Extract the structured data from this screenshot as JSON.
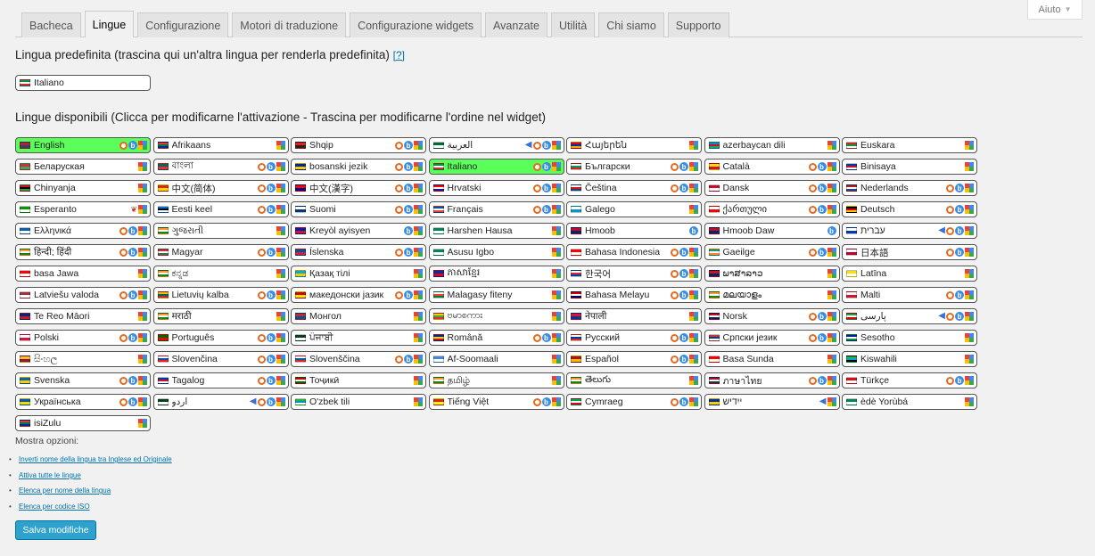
{
  "help": {
    "label": "Aiuto"
  },
  "tabs": [
    "Bacheca",
    "Lingue",
    "Configurazione",
    "Motori di traduzione",
    "Configurazione widgets",
    "Avanzate",
    "Utilità",
    "Chi siamo",
    "Supporto"
  ],
  "active_tab": "Lingue",
  "default_section": {
    "title": "Lingua predefinita (trascina qui un'altra lingua per renderla predefinita)",
    "help_link": "[?]"
  },
  "default_language": {
    "name": "Italiano",
    "flag_colors": [
      "#009246",
      "#ffffff",
      "#ce2b37"
    ]
  },
  "available_section": {
    "title": "Lingue disponibili (Clicca per modificarne l'attivazione - Trascina per modificarne l'ordine nel widget)"
  },
  "languages": [
    {
      "name": "English",
      "active": true,
      "icons": [
        "apertium",
        "bing",
        "google"
      ],
      "flag_colors": [
        "#b22234",
        "#3c3b6e"
      ]
    },
    {
      "name": "Afrikaans",
      "icons": [
        "google"
      ],
      "flag_colors": [
        "#de3831",
        "#007a4d",
        "#002395"
      ]
    },
    {
      "name": "Shqip",
      "icons": [
        "apertium",
        "bing",
        "google"
      ],
      "flag_colors": [
        "#e41e20",
        "#222222"
      ]
    },
    {
      "name": "العربية",
      "icons": [
        "arrow",
        "apertium",
        "bing",
        "google"
      ],
      "flag_colors": [
        "#006c35",
        "#ffffff"
      ]
    },
    {
      "name": "Հայերեն",
      "icons": [
        "google"
      ],
      "flag_colors": [
        "#d90012",
        "#0033a0",
        "#f2a800"
      ]
    },
    {
      "name": "azerbaycan dili",
      "icons": [
        "google"
      ],
      "flag_colors": [
        "#0092bc",
        "#e00034",
        "#00af66"
      ]
    },
    {
      "name": "Euskara",
      "icons": [
        "google"
      ],
      "flag_colors": [
        "#d52b1e",
        "#009b48",
        "#ffffff"
      ]
    },
    {
      "name": "Беларуская",
      "icons": [
        "google"
      ],
      "flag_colors": [
        "#c8313e",
        "#4aa657"
      ]
    },
    {
      "name": "বাংলা",
      "icons": [
        "apertium",
        "bing",
        "google"
      ],
      "flag_colors": [
        "#006a4e",
        "#f42a41"
      ]
    },
    {
      "name": "bosanski jezik",
      "icons": [
        "apertium",
        "bing",
        "google"
      ],
      "flag_colors": [
        "#002395",
        "#fecb00"
      ]
    },
    {
      "name": "Italiano",
      "active": true,
      "icons": [
        "apertium",
        "bing",
        "google"
      ],
      "flag_colors": [
        "#009246",
        "#ffffff",
        "#ce2b37"
      ]
    },
    {
      "name": "Български",
      "icons": [
        "apertium",
        "bing",
        "google"
      ],
      "flag_colors": [
        "#ffffff",
        "#00966e",
        "#d62612"
      ]
    },
    {
      "name": "Català",
      "icons": [
        "apertium",
        "bing",
        "google"
      ],
      "flag_colors": [
        "#fcdd09",
        "#da121a"
      ]
    },
    {
      "name": "Binisaya",
      "icons": [
        "google"
      ],
      "flag_colors": [
        "#0038a8",
        "#ce1126",
        "#ffffff"
      ]
    },
    {
      "name": "Chinyanja",
      "icons": [
        "google"
      ],
      "flag_colors": [
        "#ce1126",
        "#000000",
        "#339e35"
      ]
    },
    {
      "name": "中文(简体)",
      "icons": [
        "apertium",
        "bing",
        "google"
      ],
      "flag_colors": [
        "#de2910",
        "#ffde00"
      ]
    },
    {
      "name": "中文(漢字)",
      "icons": [
        "apertium",
        "bing",
        "google"
      ],
      "flag_colors": [
        "#fe0000",
        "#000095"
      ]
    },
    {
      "name": "Hrvatski",
      "icons": [
        "apertium",
        "bing",
        "google"
      ],
      "flag_colors": [
        "#ff0000",
        "#ffffff",
        "#171796"
      ]
    },
    {
      "name": "Čeština",
      "icons": [
        "apertium",
        "bing",
        "google"
      ],
      "flag_colors": [
        "#ffffff",
        "#d7141a",
        "#11457e"
      ]
    },
    {
      "name": "Dansk",
      "icons": [
        "apertium",
        "bing",
        "google"
      ],
      "flag_colors": [
        "#c60c30",
        "#ffffff"
      ]
    },
    {
      "name": "Nederlands",
      "icons": [
        "apertium",
        "bing",
        "google"
      ],
      "flag_colors": [
        "#ae1c28",
        "#ffffff",
        "#21468b"
      ]
    },
    {
      "name": "Esperanto",
      "icons": [
        "butterfly",
        "google"
      ],
      "flag_colors": [
        "#009900",
        "#ffffff"
      ]
    },
    {
      "name": "Eesti keel",
      "icons": [
        "apertium",
        "bing",
        "google"
      ],
      "flag_colors": [
        "#0072ce",
        "#000000",
        "#ffffff"
      ]
    },
    {
      "name": "Suomi",
      "icons": [
        "apertium",
        "bing",
        "google"
      ],
      "flag_colors": [
        "#ffffff",
        "#003580"
      ]
    },
    {
      "name": "Français",
      "icons": [
        "apertium",
        "bing",
        "google"
      ],
      "flag_colors": [
        "#0055a4",
        "#ffffff",
        "#ef4135"
      ]
    },
    {
      "name": "Galego",
      "icons": [
        "google"
      ],
      "flag_colors": [
        "#ffffff",
        "#0099cc"
      ]
    },
    {
      "name": "ქართული",
      "icons": [
        "apertium",
        "bing",
        "google"
      ],
      "flag_colors": [
        "#ffffff",
        "#ff0000"
      ]
    },
    {
      "name": "Deutsch",
      "icons": [
        "apertium",
        "bing",
        "google"
      ],
      "flag_colors": [
        "#000000",
        "#dd0000",
        "#ffce00"
      ]
    },
    {
      "name": "Ελληνικά",
      "icons": [
        "apertium",
        "bing",
        "google"
      ],
      "flag_colors": [
        "#0d5eaf",
        "#ffffff"
      ]
    },
    {
      "name": "ગુજરાતી",
      "icons": [
        "google"
      ],
      "flag_colors": [
        "#ff9933",
        "#ffffff",
        "#138808"
      ]
    },
    {
      "name": "Kreyòl ayisyen",
      "icons": [
        "bing",
        "google"
      ],
      "flag_colors": [
        "#00209f",
        "#d21034"
      ]
    },
    {
      "name": "Harshen Hausa",
      "icons": [
        "google"
      ],
      "flag_colors": [
        "#008751",
        "#ffffff"
      ]
    },
    {
      "name": "Hmoob",
      "icons": [
        "bing"
      ],
      "flag_colors": [
        "#bf0a30",
        "#002868"
      ]
    },
    {
      "name": "Hmoob Daw",
      "icons": [
        "bing"
      ],
      "flag_colors": [
        "#bf0a30",
        "#002868"
      ]
    },
    {
      "name": "עברית",
      "icons": [
        "arrow",
        "apertium",
        "bing",
        "google"
      ],
      "flag_colors": [
        "#ffffff",
        "#0038b8"
      ]
    },
    {
      "name": "हिन्दी; हिंदी",
      "icons": [
        "apertium",
        "bing",
        "google"
      ],
      "flag_colors": [
        "#ff9933",
        "#ffffff",
        "#138808"
      ]
    },
    {
      "name": "Magyar",
      "icons": [
        "apertium",
        "bing",
        "google"
      ],
      "flag_colors": [
        "#cd2a3e",
        "#ffffff",
        "#436f4d"
      ]
    },
    {
      "name": "Íslenska",
      "icons": [
        "apertium",
        "bing",
        "google"
      ],
      "flag_colors": [
        "#02529c",
        "#dc1e35"
      ]
    },
    {
      "name": "Asusu Igbo",
      "icons": [
        "google"
      ],
      "flag_colors": [
        "#008751",
        "#ffffff"
      ]
    },
    {
      "name": "Bahasa Indonesia",
      "icons": [
        "apertium",
        "bing",
        "google"
      ],
      "flag_colors": [
        "#ff0000",
        "#ffffff"
      ]
    },
    {
      "name": "Gaeilge",
      "icons": [
        "apertium",
        "bing",
        "google"
      ],
      "flag_colors": [
        "#169b62",
        "#ffffff",
        "#ff883e"
      ]
    },
    {
      "name": "日本語",
      "icons": [
        "apertium",
        "bing",
        "google"
      ],
      "flag_colors": [
        "#ffffff",
        "#bc002d"
      ]
    },
    {
      "name": "basa Jawa",
      "icons": [
        "google"
      ],
      "flag_colors": [
        "#ff0000",
        "#ffffff"
      ]
    },
    {
      "name": "ಕನ್ನಡ",
      "icons": [
        "google"
      ],
      "flag_colors": [
        "#ff9933",
        "#ffffff",
        "#138808"
      ]
    },
    {
      "name": "Қазақ тілі",
      "icons": [
        "google"
      ],
      "flag_colors": [
        "#00afca",
        "#fec50c"
      ]
    },
    {
      "name": "ភាសាខ្មែរ",
      "icons": [
        "google"
      ],
      "flag_colors": [
        "#032ea1",
        "#e00025"
      ]
    },
    {
      "name": "한국어",
      "icons": [
        "apertium",
        "bing",
        "google"
      ],
      "flag_colors": [
        "#ffffff",
        "#cd2e3a",
        "#0047a0"
      ]
    },
    {
      "name": "ພາສາລາວ",
      "icons": [
        "google"
      ],
      "flag_colors": [
        "#ce1126",
        "#002868"
      ]
    },
    {
      "name": "Latīna",
      "icons": [
        "google"
      ],
      "flag_colors": [
        "#ffe000",
        "#ffffff"
      ]
    },
    {
      "name": "Latviešu valoda",
      "icons": [
        "apertium",
        "bing",
        "google"
      ],
      "flag_colors": [
        "#9e3039",
        "#ffffff"
      ]
    },
    {
      "name": "Lietuvių kalba",
      "icons": [
        "apertium",
        "bing",
        "google"
      ],
      "flag_colors": [
        "#fdb913",
        "#006a44",
        "#c1272d"
      ]
    },
    {
      "name": "македонски јазик",
      "icons": [
        "apertium",
        "bing",
        "google"
      ],
      "flag_colors": [
        "#d20000",
        "#ffe600"
      ]
    },
    {
      "name": "Malagasy fiteny",
      "icons": [
        "google"
      ],
      "flag_colors": [
        "#ffffff",
        "#fc3d32",
        "#007e3a"
      ]
    },
    {
      "name": "Bahasa Melayu",
      "icons": [
        "apertium",
        "bing",
        "google"
      ],
      "flag_colors": [
        "#cc0001",
        "#ffffff",
        "#010066"
      ]
    },
    {
      "name": "മലയാളം",
      "icons": [
        "google"
      ],
      "flag_colors": [
        "#ff9933",
        "#ffffff",
        "#138808"
      ]
    },
    {
      "name": "Malti",
      "icons": [
        "apertium",
        "bing",
        "google"
      ],
      "flag_colors": [
        "#ffffff",
        "#cf142b"
      ]
    },
    {
      "name": "Te Reo Māori",
      "icons": [
        "google"
      ],
      "flag_colors": [
        "#00247d",
        "#cc142b"
      ]
    },
    {
      "name": "मराठी",
      "icons": [
        "google"
      ],
      "flag_colors": [
        "#ff9933",
        "#ffffff",
        "#138808"
      ]
    },
    {
      "name": "Монгол",
      "icons": [
        "google"
      ],
      "flag_colors": [
        "#c4272f",
        "#015197"
      ]
    },
    {
      "name": "ဗမာစကား",
      "icons": [
        "google"
      ],
      "flag_colors": [
        "#fecb00",
        "#34b233",
        "#ea2839"
      ]
    },
    {
      "name": "नेपाली",
      "icons": [
        "google"
      ],
      "flag_colors": [
        "#dc143c",
        "#003893"
      ]
    },
    {
      "name": "Norsk",
      "icons": [
        "apertium",
        "bing",
        "google"
      ],
      "flag_colors": [
        "#ba0c2f",
        "#ffffff",
        "#00205b"
      ]
    },
    {
      "name": "پارسی",
      "icons": [
        "arrow",
        "apertium",
        "bing",
        "google"
      ],
      "flag_colors": [
        "#239f40",
        "#ffffff",
        "#da0000"
      ]
    },
    {
      "name": "Polski",
      "icons": [
        "apertium",
        "bing",
        "google"
      ],
      "flag_colors": [
        "#ffffff",
        "#dc143c"
      ]
    },
    {
      "name": "Português",
      "icons": [
        "apertium",
        "bing",
        "google"
      ],
      "flag_colors": [
        "#006600",
        "#ff0000"
      ]
    },
    {
      "name": "ਪੰਜਾਬੀ",
      "icons": [
        "google"
      ],
      "flag_colors": [
        "#01411c",
        "#ffffff"
      ]
    },
    {
      "name": "Română",
      "icons": [
        "apertium",
        "bing",
        "google"
      ],
      "flag_colors": [
        "#002b7f",
        "#fcd116",
        "#ce1126"
      ]
    },
    {
      "name": "Русский",
      "icons": [
        "apertium",
        "bing",
        "google"
      ],
      "flag_colors": [
        "#ffffff",
        "#0039a6",
        "#d52b1e"
      ]
    },
    {
      "name": "Српски језик",
      "icons": [
        "apertium",
        "bing",
        "google"
      ],
      "flag_colors": [
        "#c6363c",
        "#0c4076",
        "#ffffff"
      ]
    },
    {
      "name": "Sesotho",
      "icons": [
        "google"
      ],
      "flag_colors": [
        "#00209f",
        "#ffffff",
        "#009543"
      ]
    },
    {
      "name": "සිංහල",
      "icons": [
        "google"
      ],
      "flag_colors": [
        "#ffbe29",
        "#8d153a"
      ]
    },
    {
      "name": "Slovenčina",
      "icons": [
        "apertium",
        "bing",
        "google"
      ],
      "flag_colors": [
        "#ffffff",
        "#0b4ea2",
        "#ee1c25"
      ]
    },
    {
      "name": "Slovenščina",
      "icons": [
        "apertium",
        "bing",
        "google"
      ],
      "flag_colors": [
        "#ffffff",
        "#005da4",
        "#ed1c24"
      ]
    },
    {
      "name": "Af-Soomaali",
      "icons": [
        "google"
      ],
      "flag_colors": [
        "#4189dd",
        "#ffffff"
      ]
    },
    {
      "name": "Español",
      "icons": [
        "apertium",
        "bing",
        "google"
      ],
      "flag_colors": [
        "#aa151b",
        "#f1bf00"
      ]
    },
    {
      "name": "Basa Sunda",
      "icons": [
        "google"
      ],
      "flag_colors": [
        "#ff0000",
        "#ffffff"
      ]
    },
    {
      "name": "Kiswahili",
      "icons": [
        "google"
      ],
      "flag_colors": [
        "#1eb53a",
        "#00a3dd",
        "#000000"
      ]
    },
    {
      "name": "Svenska",
      "icons": [
        "apertium",
        "bing",
        "google"
      ],
      "flag_colors": [
        "#006aa7",
        "#fecc00"
      ]
    },
    {
      "name": "Tagalog",
      "icons": [
        "apertium",
        "bing",
        "google"
      ],
      "flag_colors": [
        "#0038a8",
        "#ce1126",
        "#ffffff"
      ]
    },
    {
      "name": "Тоҷикӣ",
      "icons": [
        "google"
      ],
      "flag_colors": [
        "#cc0000",
        "#ffffff",
        "#006600"
      ]
    },
    {
      "name": "தமிழ்",
      "icons": [
        "google"
      ],
      "flag_colors": [
        "#ff9933",
        "#ffffff",
        "#138808"
      ]
    },
    {
      "name": "తెలుగు",
      "icons": [
        "google"
      ],
      "flag_colors": [
        "#ff9933",
        "#ffffff",
        "#138808"
      ]
    },
    {
      "name": "ภาษาไทย",
      "icons": [
        "apertium",
        "bing",
        "google"
      ],
      "flag_colors": [
        "#a51931",
        "#f4f5f8",
        "#2d2a4a"
      ]
    },
    {
      "name": "Türkçe",
      "icons": [
        "apertium",
        "bing",
        "google"
      ],
      "flag_colors": [
        "#e30a17",
        "#ffffff"
      ]
    },
    {
      "name": "Українська",
      "icons": [
        "apertium",
        "bing",
        "google"
      ],
      "flag_colors": [
        "#0057b7",
        "#ffd700"
      ]
    },
    {
      "name": "اردو",
      "icons": [
        "arrow",
        "apertium",
        "bing",
        "google"
      ],
      "flag_colors": [
        "#01411c",
        "#ffffff"
      ]
    },
    {
      "name": "O'zbek tili",
      "icons": [
        "google"
      ],
      "flag_colors": [
        "#1eb53a",
        "#0099b5",
        "#ffffff"
      ]
    },
    {
      "name": "Tiếng Việt",
      "icons": [
        "apertium",
        "bing",
        "google"
      ],
      "flag_colors": [
        "#da251d",
        "#ffff00"
      ]
    },
    {
      "name": "Cymraeg",
      "icons": [
        "apertium",
        "bing",
        "google"
      ],
      "flag_colors": [
        "#00ab39",
        "#ffffff",
        "#d30731"
      ]
    },
    {
      "name": "ייִדיש",
      "icons": [
        "arrow",
        "google"
      ],
      "flag_colors": [
        "#003399",
        "#ffcc00"
      ]
    },
    {
      "name": "èdè Yorùbá",
      "icons": [
        "google"
      ],
      "flag_colors": [
        "#008751",
        "#ffffff"
      ]
    },
    {
      "name": "isiZulu",
      "icons": [
        "google"
      ],
      "flag_colors": [
        "#de3831",
        "#007a4d",
        "#002395"
      ]
    }
  ],
  "options": {
    "title": "Mostra opzioni:",
    "links": [
      "Inverti nome della lingua tra Inglese ed Originale",
      "Attiva tutte le lingue",
      "Elenca per nome della lingua",
      "Elenca per codice ISO"
    ]
  },
  "save_button": "Salva modifiche",
  "colors": {
    "accent": "#2ea2cc",
    "active_language": "#5aff5a",
    "link": "#0073aa"
  }
}
